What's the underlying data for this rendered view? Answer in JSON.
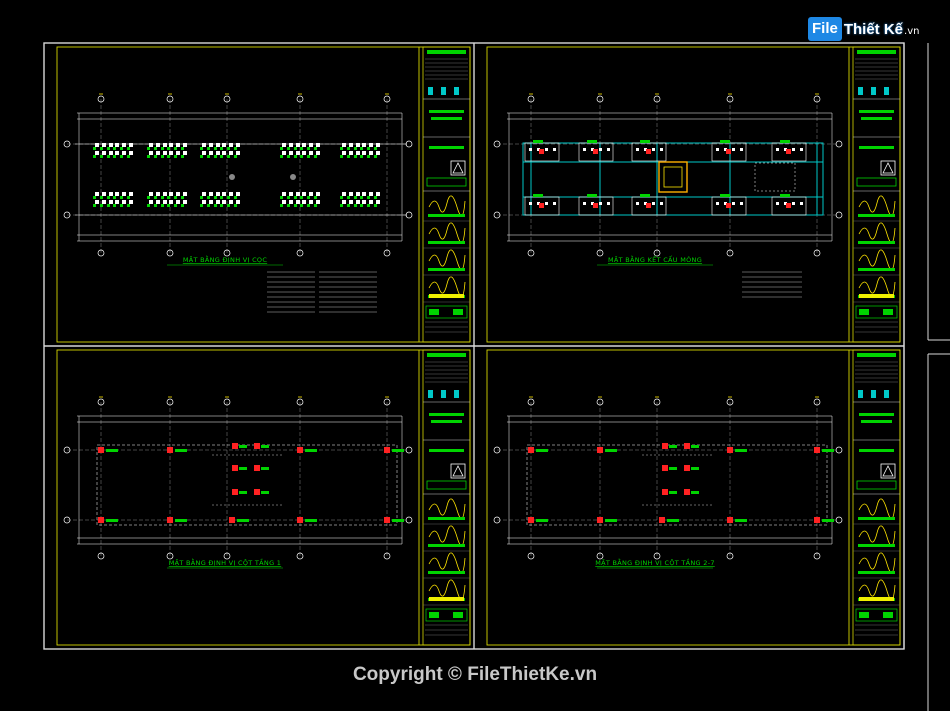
{
  "logo": {
    "part1": "File",
    "part2": "Thiết Kế",
    "part3": ".vn"
  },
  "copyright": "Copyright © FileThietKe.vn",
  "colors": {
    "sheet_border": "#d8d8d8",
    "panel_border": "#d6d600",
    "grid": "#ffffff",
    "label": "#00d400",
    "column": "#ff2222",
    "cyan": "#00c8c8",
    "background": "#000000"
  },
  "drawings": [
    {
      "title": "MẶT BẰNG ĐỊNH VỊ CỌC",
      "kind": "piles"
    },
    {
      "title": "MẶT BẰNG KẾT CẤU MÓNG",
      "kind": "foundation"
    },
    {
      "title": "MẶT BẰNG ĐỊNH VỊ CỘT TẦNG 1",
      "kind": "columns"
    },
    {
      "title": "MẶT BẰNG ĐỊNH VỊ CỘT TẦNG 2-7",
      "kind": "columns"
    }
  ]
}
